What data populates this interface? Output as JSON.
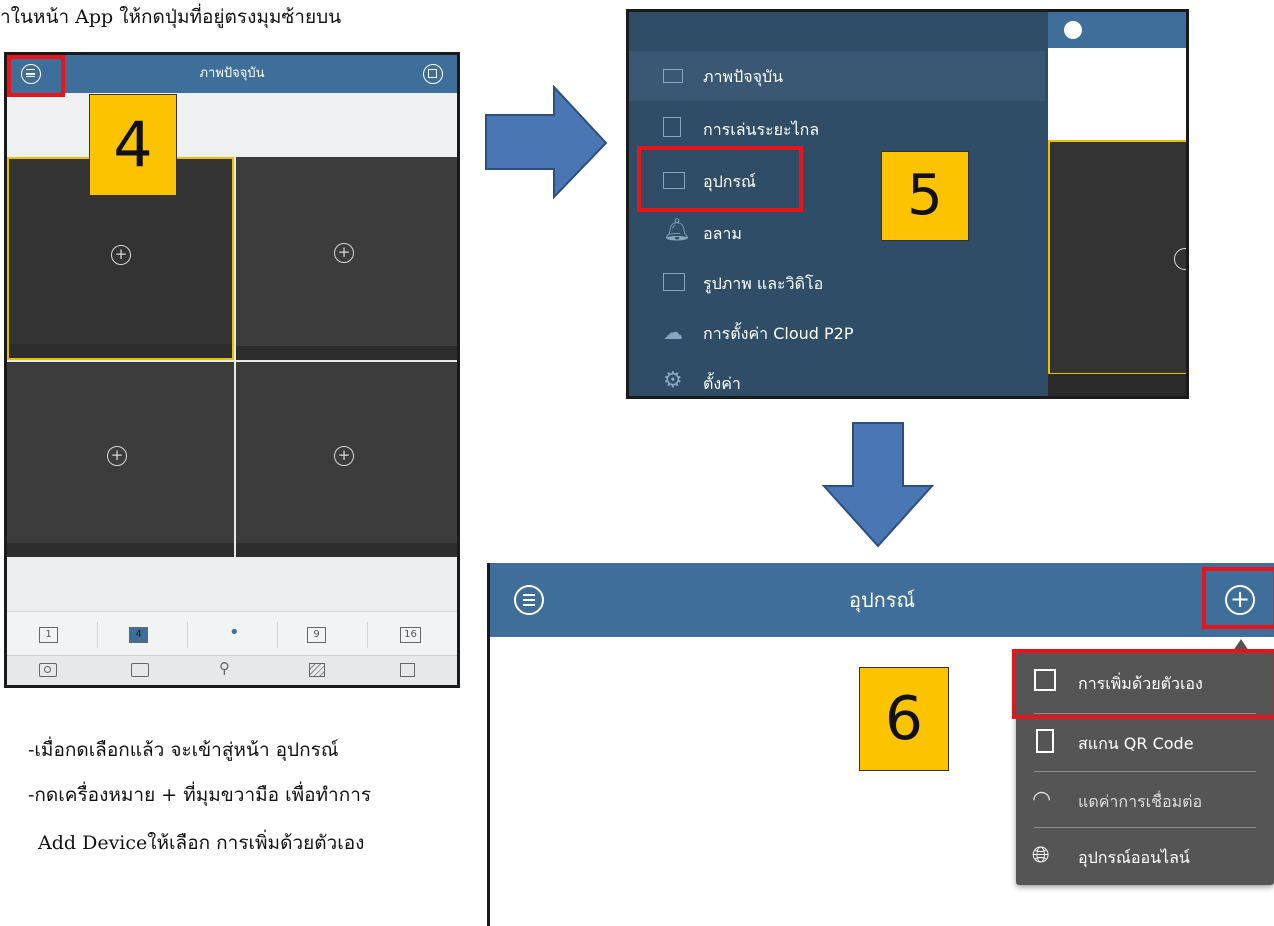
{
  "top_caption": "าในหน้า App ให้กดปุ่มที่อยู่ตรงมุมซ้ายบน",
  "panel1": {
    "title": "ภาพปัจจุบัน",
    "menu_icon": "menu-icon",
    "step_number": "4",
    "grid_plus": "+",
    "split_options": [
      "1",
      "4",
      "•",
      "9",
      "16"
    ],
    "toolbar_icons": [
      "camera-icon",
      "record-icon",
      "ptz-icon",
      "image-quality-icon",
      "close-all-icon"
    ]
  },
  "panel2": {
    "step_number": "5",
    "menu_items": [
      {
        "label": "ภาพปัจจุบัน",
        "icon": "camera-icon"
      },
      {
        "label": "การเล่นระยะไกล",
        "icon": "playback-icon"
      },
      {
        "label": "อุปกรณ์",
        "icon": "device-icon"
      },
      {
        "label": "อลาม",
        "icon": "bell-icon"
      },
      {
        "label": "รูปภาพ และวิดิโอ",
        "icon": "picture-icon"
      },
      {
        "label": "การตั้งค่า Cloud P2P",
        "icon": "cloud-icon"
      },
      {
        "label": "ตั้งค่า",
        "icon": "gear-icon"
      }
    ]
  },
  "panel3": {
    "title": "อุปกรณ์",
    "step_number": "6",
    "popup_items": [
      {
        "label": "การเพิ่มด้วยตัวเอง",
        "icon": "edit-icon"
      },
      {
        "label": "สแกน QR Code",
        "icon": "qr-icon"
      },
      {
        "label": "แดค่าการเชื่อมต่อ",
        "icon": "wifi-icon"
      },
      {
        "label": "อุปกรณ์ออนไลน์",
        "icon": "globe-icon"
      }
    ]
  },
  "instructions": [
    "-เมื่อกดเลือกแล้ว จะเข้าสู่หน้า อุปกรณ์",
    "-กดเครื่องหมาย + ที่มุมขวามือ เพื่อทำการ",
    "Add  Deviceให้เลือก การเพิ่มด้วยตัวเอง"
  ],
  "colors": {
    "header_blue": "#3e6e99",
    "menu_bg": "#2f4d66",
    "step_yellow": "#fcc400",
    "highlight_red": "#e8141c",
    "arrow_blue": "#4a76b4"
  }
}
